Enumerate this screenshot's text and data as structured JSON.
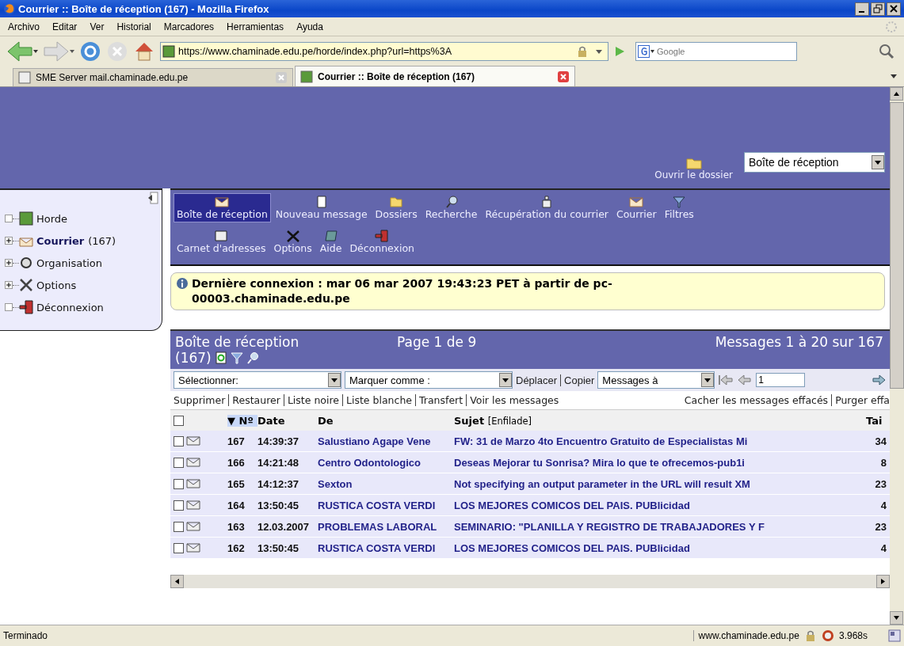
{
  "window": {
    "title": "Courrier :: Boîte de réception (167) - Mozilla Firefox"
  },
  "menu": [
    "Archivo",
    "Editar",
    "Ver",
    "Historial",
    "Marcadores",
    "Herramientas",
    "Ayuda"
  ],
  "address_bar": {
    "value": "https://www.chaminade.edu.pe/horde/index.php?url=https%3A"
  },
  "search": {
    "placeholder": "Google"
  },
  "tabs": [
    {
      "label": "SME Server mail.chaminade.edu.pe",
      "selected": false
    },
    {
      "label": "Courrier :: Boîte de réception (167)",
      "selected": true
    }
  ],
  "folder_picker": {
    "label": "Ouvrir le dossier",
    "value": "Boîte de réception"
  },
  "sidebar": {
    "items": [
      {
        "label": "Horde",
        "kind": "leaf"
      },
      {
        "label": "Courrier",
        "count": "(167)",
        "kind": "folder",
        "expanded": false
      },
      {
        "label": "Organisation",
        "kind": "folder",
        "expanded": false
      },
      {
        "label": "Options",
        "kind": "folder",
        "expanded": false
      },
      {
        "label": "Déconnexion",
        "kind": "leaf"
      }
    ]
  },
  "toolbar": {
    "items": [
      {
        "label": "Boîte de réception",
        "selected": true
      },
      {
        "label": "Nouveau message",
        "selected": false
      },
      {
        "label": "Dossiers",
        "selected": false
      },
      {
        "label": "Recherche",
        "selected": false
      },
      {
        "label": "Récupération du courrier",
        "selected": false
      },
      {
        "label": "Courrier",
        "selected": false
      },
      {
        "label": "Filtres",
        "selected": false
      },
      {
        "label": "Carnet d'adresses",
        "selected": false
      },
      {
        "label": "Options",
        "selected": false
      },
      {
        "label": "Aide",
        "selected": false
      },
      {
        "label": "Déconnexion",
        "selected": false
      }
    ]
  },
  "notice": "Dernière connexion : mar 06 mar 2007 19:43:23 PET à partir de pc-00003.chaminade.edu.pe",
  "mailbox": {
    "title": "Boîte de réception",
    "count": "(167)",
    "page": "Page 1 de 9",
    "range": "Messages 1 à 20 sur 167"
  },
  "controls": {
    "select_label": "Sélectionner:",
    "mark_label": "Marquer comme :",
    "move": "Déplacer",
    "copy": "Copier",
    "target": "Messages à",
    "page_value": "1"
  },
  "actions": {
    "left": [
      "Supprimer",
      "Restaurer",
      "Liste noire",
      "Liste blanche",
      "Transfert",
      "Voir les messages"
    ],
    "right": [
      "Cacher les messages effacés",
      "Purger effa"
    ]
  },
  "table": {
    "select_all_checked": false,
    "sort_indicator": "▼",
    "columns": [
      "Nº",
      "Date",
      "De",
      "Sujet",
      "Tai"
    ],
    "subject_suffix": "[Enfilade]",
    "rows": [
      {
        "checked": false,
        "number": "167",
        "date": "14:39:37",
        "from": "Salustiano Agape Vene",
        "subject": "FW: 31 de Marzo 4to Encuentro Gratuito de Especialistas Mi",
        "size": "34"
      },
      {
        "checked": false,
        "number": "166",
        "date": "14:21:48",
        "from": "Centro Odontologico",
        "subject": "Deseas Mejorar tu Sonrisa? Mira lo que te ofrecemos-pub1i",
        "size": "8"
      },
      {
        "checked": false,
        "number": "165",
        "date": "14:12:37",
        "from": "Sexton",
        "subject": "Not specifying an output parameter in the URL will result XM",
        "size": "23"
      },
      {
        "checked": false,
        "number": "164",
        "date": "13:50:45",
        "from": "RUSTICA COSTA VERDI",
        "subject": "LOS MEJORES COMICOS DEL PAIS. PUBlicidad",
        "size": "4"
      },
      {
        "checked": false,
        "number": "163",
        "date": "12.03.2007",
        "from": "PROBLEMAS LABORAL",
        "subject": "SEMINARIO: \"PLANILLA Y REGISTRO DE TRABAJADORES Y F",
        "size": "23"
      },
      {
        "checked": false,
        "number": "162",
        "date": "13:50:45",
        "from": "RUSTICA COSTA VERDI",
        "subject": "LOS MEJORES COMICOS DEL PAIS. PUBlicidad",
        "size": "4"
      }
    ]
  },
  "status_bar": {
    "text": "Terminado",
    "host": "www.chaminade.edu.pe",
    "time": "3.968s"
  }
}
